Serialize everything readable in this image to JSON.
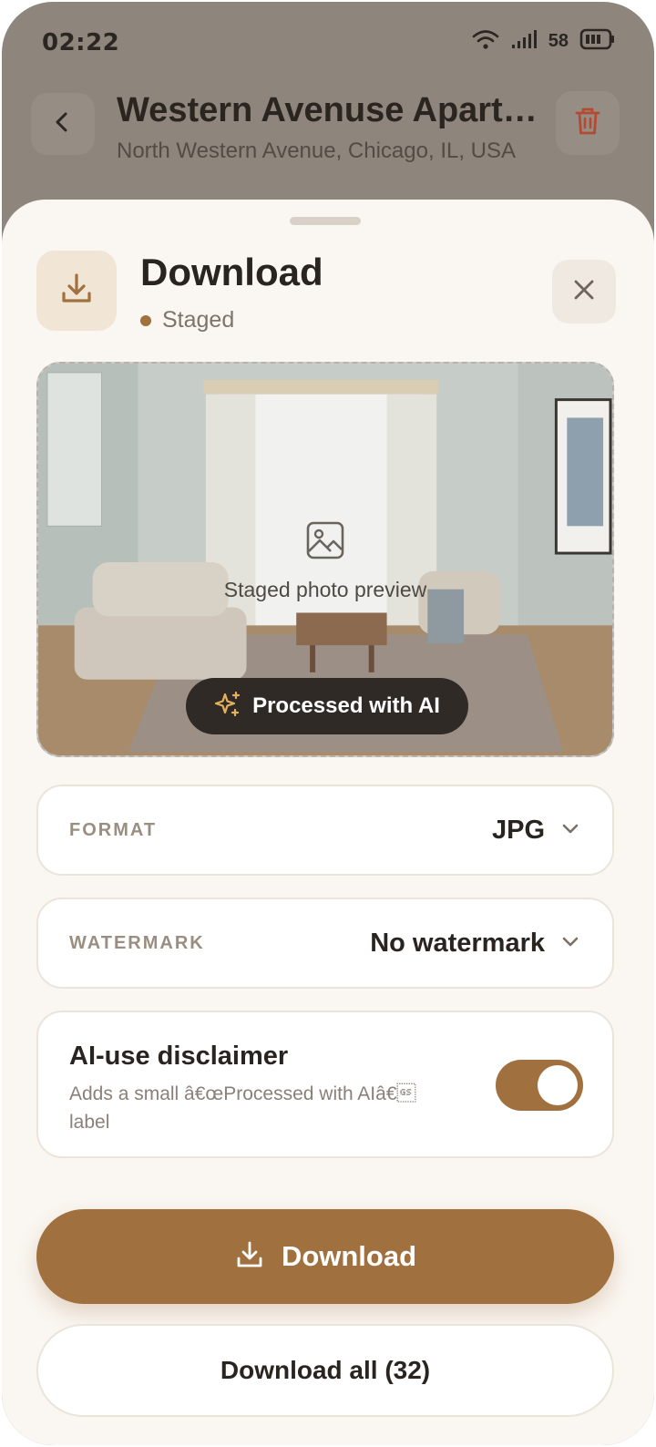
{
  "status_bar": {
    "time": "02:22",
    "battery": "58"
  },
  "header": {
    "title": "Western Avenuse Apartment",
    "subtitle": "North Western Avenue, Chicago, IL, USA"
  },
  "sheet": {
    "title": "Download",
    "status": "Staged",
    "preview": {
      "placeholder_label": "Staged photo preview",
      "badge_label": "Processed with AI"
    },
    "format": {
      "label": "FORMAT",
      "value": "JPG"
    },
    "watermark": {
      "label": "WATERMARK",
      "value": "No watermark"
    },
    "disclaimer": {
      "title": "AI-use disclaimer",
      "description": "Adds a small â€œProcessed with AIâ€\u001d label",
      "enabled": true
    },
    "primary_button": "Download",
    "secondary_button": "Download all (32)"
  },
  "colors": {
    "accent": "#a0703f",
    "sheet_background": "#faf6f1",
    "overlay": "#8e857d",
    "badge_background": "#2f2a26",
    "danger_icon": "#b54a32"
  },
  "icons": {
    "back": "chevron-left-icon",
    "trash": "trash-icon",
    "download": "download-icon",
    "close": "close-icon",
    "image": "image-icon",
    "sparkle": "sparkle-icon",
    "chevron": "chevron-down-icon"
  }
}
